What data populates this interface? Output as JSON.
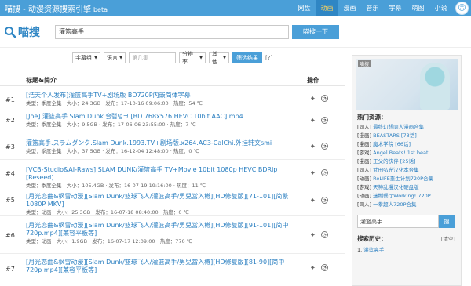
{
  "header": {
    "title": "喵搜 - 动漫资源搜索引擎",
    "beta": "beta",
    "nav": [
      "网盘",
      "动画",
      "漫画",
      "音乐",
      "字幕",
      "萌图",
      "小说"
    ],
    "active_nav": "动画",
    "accent": "#4a9fd8"
  },
  "search": {
    "logo_text": "喵搜",
    "query": "灌篮高手",
    "button": "喵搜一下"
  },
  "filters": {
    "selects": [
      "字幕组",
      "语言",
      "分辨率",
      "其他"
    ],
    "episode_placeholder": "第几集",
    "filter_button": "筛选结果",
    "help": "[?]"
  },
  "table": {
    "col_title": "标题&简介",
    "col_ops": "操作",
    "rows": [
      {
        "num": "#1",
        "title": "[浩天个人发布]灌篮高手TV+剧场版 BD720P内嵌简体字幕",
        "meta": "类型：季度全集 · 大小：24.3GB · 发布：17-10-16 09:06:00 · 热度：54 ℃"
      },
      {
        "num": "#2",
        "title": "[Joe] 灌篮高手.Slam Dunk.슬램덩크 [BD 768x576 HEVC 10bit AAC].mp4",
        "meta": "类型：季度全集 · 大小：9.5GB · 发布：17-06-06 23:55:00 · 热度：7 ℃"
      },
      {
        "num": "#3",
        "title": "灌篮高手.スラムダンク.Slam Dunk.1993.TV+剧场版.x264.AC3-CalChi.外挂韩文smi",
        "meta": "类型：季度全集 · 大小：37.5GB · 发布：16-12-04 12:48:00 · 热度：0 ℃"
      },
      {
        "num": "#4",
        "title": "[VCB-Studio&AI-Raws] SLAM DUNK/灌篮高手 TV+Movie 10bit 1080p HEVC BDRip [Reseed]",
        "meta": "类型：季度全集 · 大小：105.4GB · 发布：16-07-19 19:16:00 · 热度：11 ℃"
      },
      {
        "num": "#5",
        "title": "[月光恋曲&枫雪动漫][Slam Dunk/篮球飞人/灌篮高手/男兒當入樽][HD修复版][71-101][简繁1080P MKV]",
        "meta": "类型：动画 · 大小：25.3GB · 发布：16-07-18 08:40:00 · 热度：0 ℃"
      },
      {
        "num": "#6",
        "title": "[月光恋曲&枫雪动漫][Slam Dunk/篮球飞人/灌篮高手/男兒當入樽][HD修复版][91-101][简中720p.mp4][兼容平板等]",
        "meta": "类型：动画 · 大小：1.9GB · 发布：16-07-17 12:09:00 · 热度：770 ℃"
      },
      {
        "num": "#7",
        "title": "[月光恋曲&枫雪动漫][Slam Dunk/篮球飞人/灌篮高手/男兒當入樽][HD修复版][81-90][简中720p mp4][兼容平板等]",
        "meta": ""
      }
    ]
  },
  "sidebar": {
    "banner_tag": "喵搜",
    "hot_title": "热门资源：",
    "hot": [
      {
        "tag": "[同人]",
        "name": "最终幻想同人漫画合集"
      },
      {
        "tag": "[漫画]",
        "name": "BEASTARS [73话]"
      },
      {
        "tag": "[漫画]",
        "name": "魔术学院 [66话]"
      },
      {
        "tag": "[游戏]",
        "name": "Angel Beats! 1st beat"
      },
      {
        "tag": "[漫画]",
        "name": "王父的快伴 [25话]"
      },
      {
        "tag": "[同人]",
        "name": "武田弘光汉化本合集"
      },
      {
        "tag": "[动画]",
        "name": "ReLIFE重生计划720P合集"
      },
      {
        "tag": "[游戏]",
        "name": "天神乱漫汉化硬盘版"
      },
      {
        "tag": "[动画]",
        "name": "迷糊餐厅Working! 720P"
      },
      {
        "tag": "[同人]",
        "name": "一拳超人720P合集"
      }
    ],
    "search_value": "灌篮高手",
    "search_button": "搜",
    "history_title": "搜索历史：",
    "history_clear": "[清空]",
    "history": [
      {
        "num": "1.",
        "name": "灌篮高手"
      }
    ]
  }
}
